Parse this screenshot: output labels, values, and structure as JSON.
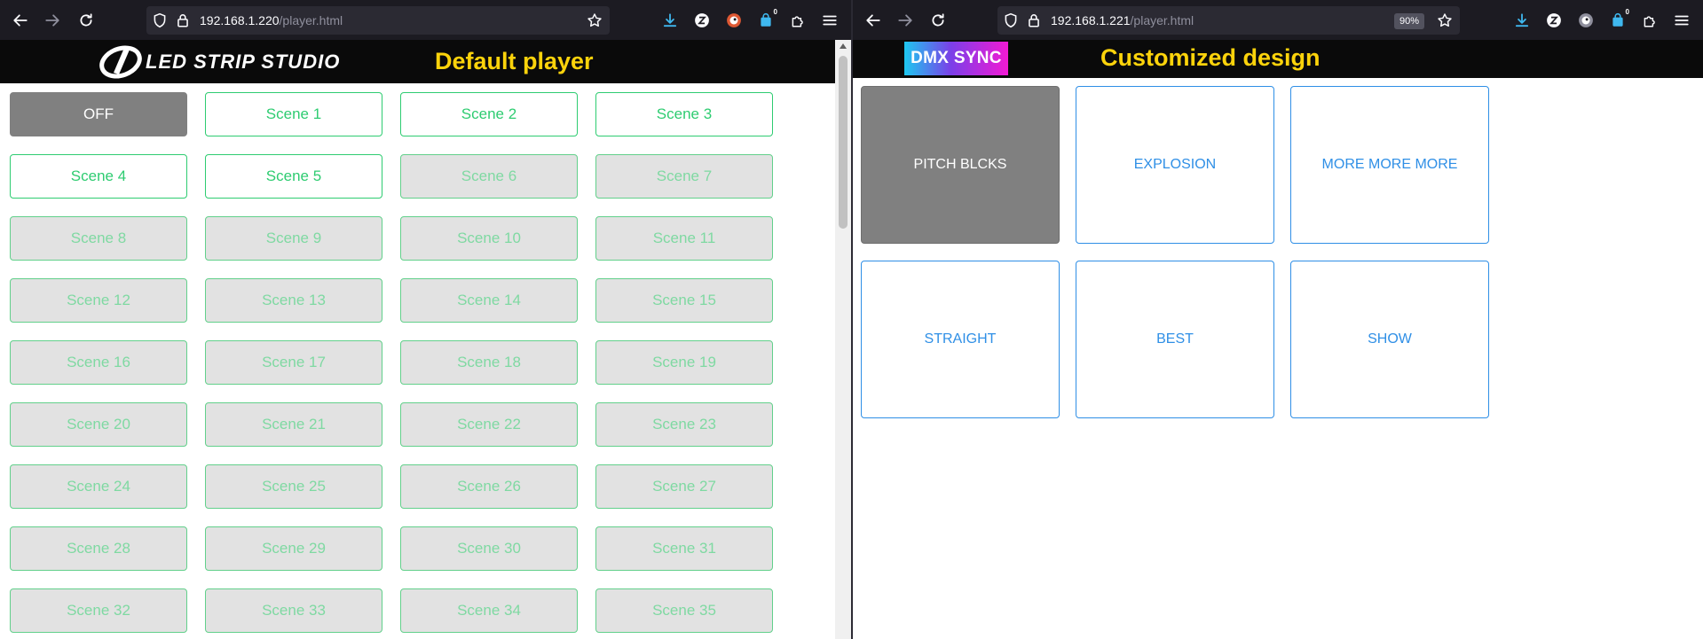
{
  "left_window": {
    "url_host": "192.168.1.220",
    "url_path": "/player.html",
    "extension_badge": "0",
    "header": {
      "logo_text": "LED STRIP STUDIO",
      "title": "Default player"
    },
    "scenes": [
      {
        "label": "OFF",
        "state": "off"
      },
      {
        "label": "Scene 1",
        "state": "active"
      },
      {
        "label": "Scene 2",
        "state": "active"
      },
      {
        "label": "Scene 3",
        "state": "active"
      },
      {
        "label": "Scene 4",
        "state": "active"
      },
      {
        "label": "Scene 5",
        "state": "active"
      },
      {
        "label": "Scene 6",
        "state": "dim"
      },
      {
        "label": "Scene 7",
        "state": "dim"
      },
      {
        "label": "Scene 8",
        "state": "dim"
      },
      {
        "label": "Scene 9",
        "state": "dim"
      },
      {
        "label": "Scene 10",
        "state": "dim"
      },
      {
        "label": "Scene 11",
        "state": "dim"
      },
      {
        "label": "Scene 12",
        "state": "dim"
      },
      {
        "label": "Scene 13",
        "state": "dim"
      },
      {
        "label": "Scene 14",
        "state": "dim"
      },
      {
        "label": "Scene 15",
        "state": "dim"
      },
      {
        "label": "Scene 16",
        "state": "dim"
      },
      {
        "label": "Scene 17",
        "state": "dim"
      },
      {
        "label": "Scene 18",
        "state": "dim"
      },
      {
        "label": "Scene 19",
        "state": "dim"
      },
      {
        "label": "Scene 20",
        "state": "dim"
      },
      {
        "label": "Scene 21",
        "state": "dim"
      },
      {
        "label": "Scene 22",
        "state": "dim"
      },
      {
        "label": "Scene 23",
        "state": "dim"
      },
      {
        "label": "Scene 24",
        "state": "dim"
      },
      {
        "label": "Scene 25",
        "state": "dim"
      },
      {
        "label": "Scene 26",
        "state": "dim"
      },
      {
        "label": "Scene 27",
        "state": "dim"
      },
      {
        "label": "Scene 28",
        "state": "dim"
      },
      {
        "label": "Scene 29",
        "state": "dim"
      },
      {
        "label": "Scene 30",
        "state": "dim"
      },
      {
        "label": "Scene 31",
        "state": "dim"
      },
      {
        "label": "Scene 32",
        "state": "dim"
      },
      {
        "label": "Scene 33",
        "state": "dim"
      },
      {
        "label": "Scene 34",
        "state": "dim"
      },
      {
        "label": "Scene 35",
        "state": "dim"
      }
    ]
  },
  "right_window": {
    "url_host": "192.168.1.221",
    "url_path": "/player.html",
    "zoom": "90%",
    "extension_badge": "0",
    "header": {
      "logo_text": "DMX SYNC",
      "title": "Customized design"
    },
    "buttons": [
      {
        "label": "PITCH BLCKS",
        "state": "active"
      },
      {
        "label": "EXPLOSION",
        "state": "normal"
      },
      {
        "label": "MORE MORE MORE",
        "state": "normal"
      },
      {
        "label": "STRAIGHT",
        "state": "normal"
      },
      {
        "label": "BEST",
        "state": "normal"
      },
      {
        "label": "SHOW",
        "state": "normal"
      }
    ]
  },
  "colors": {
    "title_yellow": "#fcd30b",
    "scene_green": "#2ecc71",
    "design_blue": "#2f8fe6",
    "off_grey": "#808080"
  }
}
